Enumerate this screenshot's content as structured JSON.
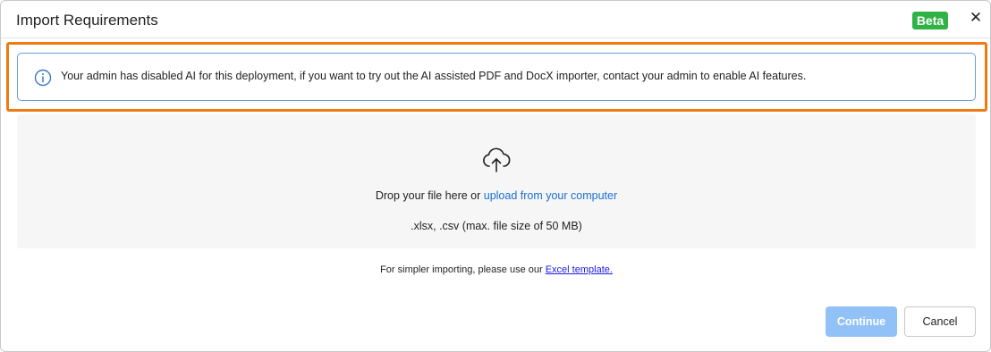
{
  "dialog": {
    "title": "Import Requirements",
    "badge": "Beta",
    "close_glyph": "✕"
  },
  "alert": {
    "icon": "info-circle-icon",
    "message": "Your admin has disabled AI for this deployment, if you want to try out the AI assisted PDF and DocX importer, contact your admin to enable AI features."
  },
  "dropzone": {
    "icon": "cloud-upload-icon",
    "prompt": "Drop your file here or ",
    "link": "upload from your computer",
    "file_types": ".xlsx, .csv (max. file size of 50 MB)"
  },
  "template": {
    "text": "For simpler importing, please use our ",
    "link": "Excel template."
  },
  "buttons": {
    "continue": "Continue",
    "cancel": "Cancel"
  },
  "colors": {
    "badge": "#2fb344",
    "highlight": "#f07a12",
    "alert_border": "#6a9ed8",
    "link": "#1a6fd0",
    "continue_disabled": "#92c1f8"
  }
}
